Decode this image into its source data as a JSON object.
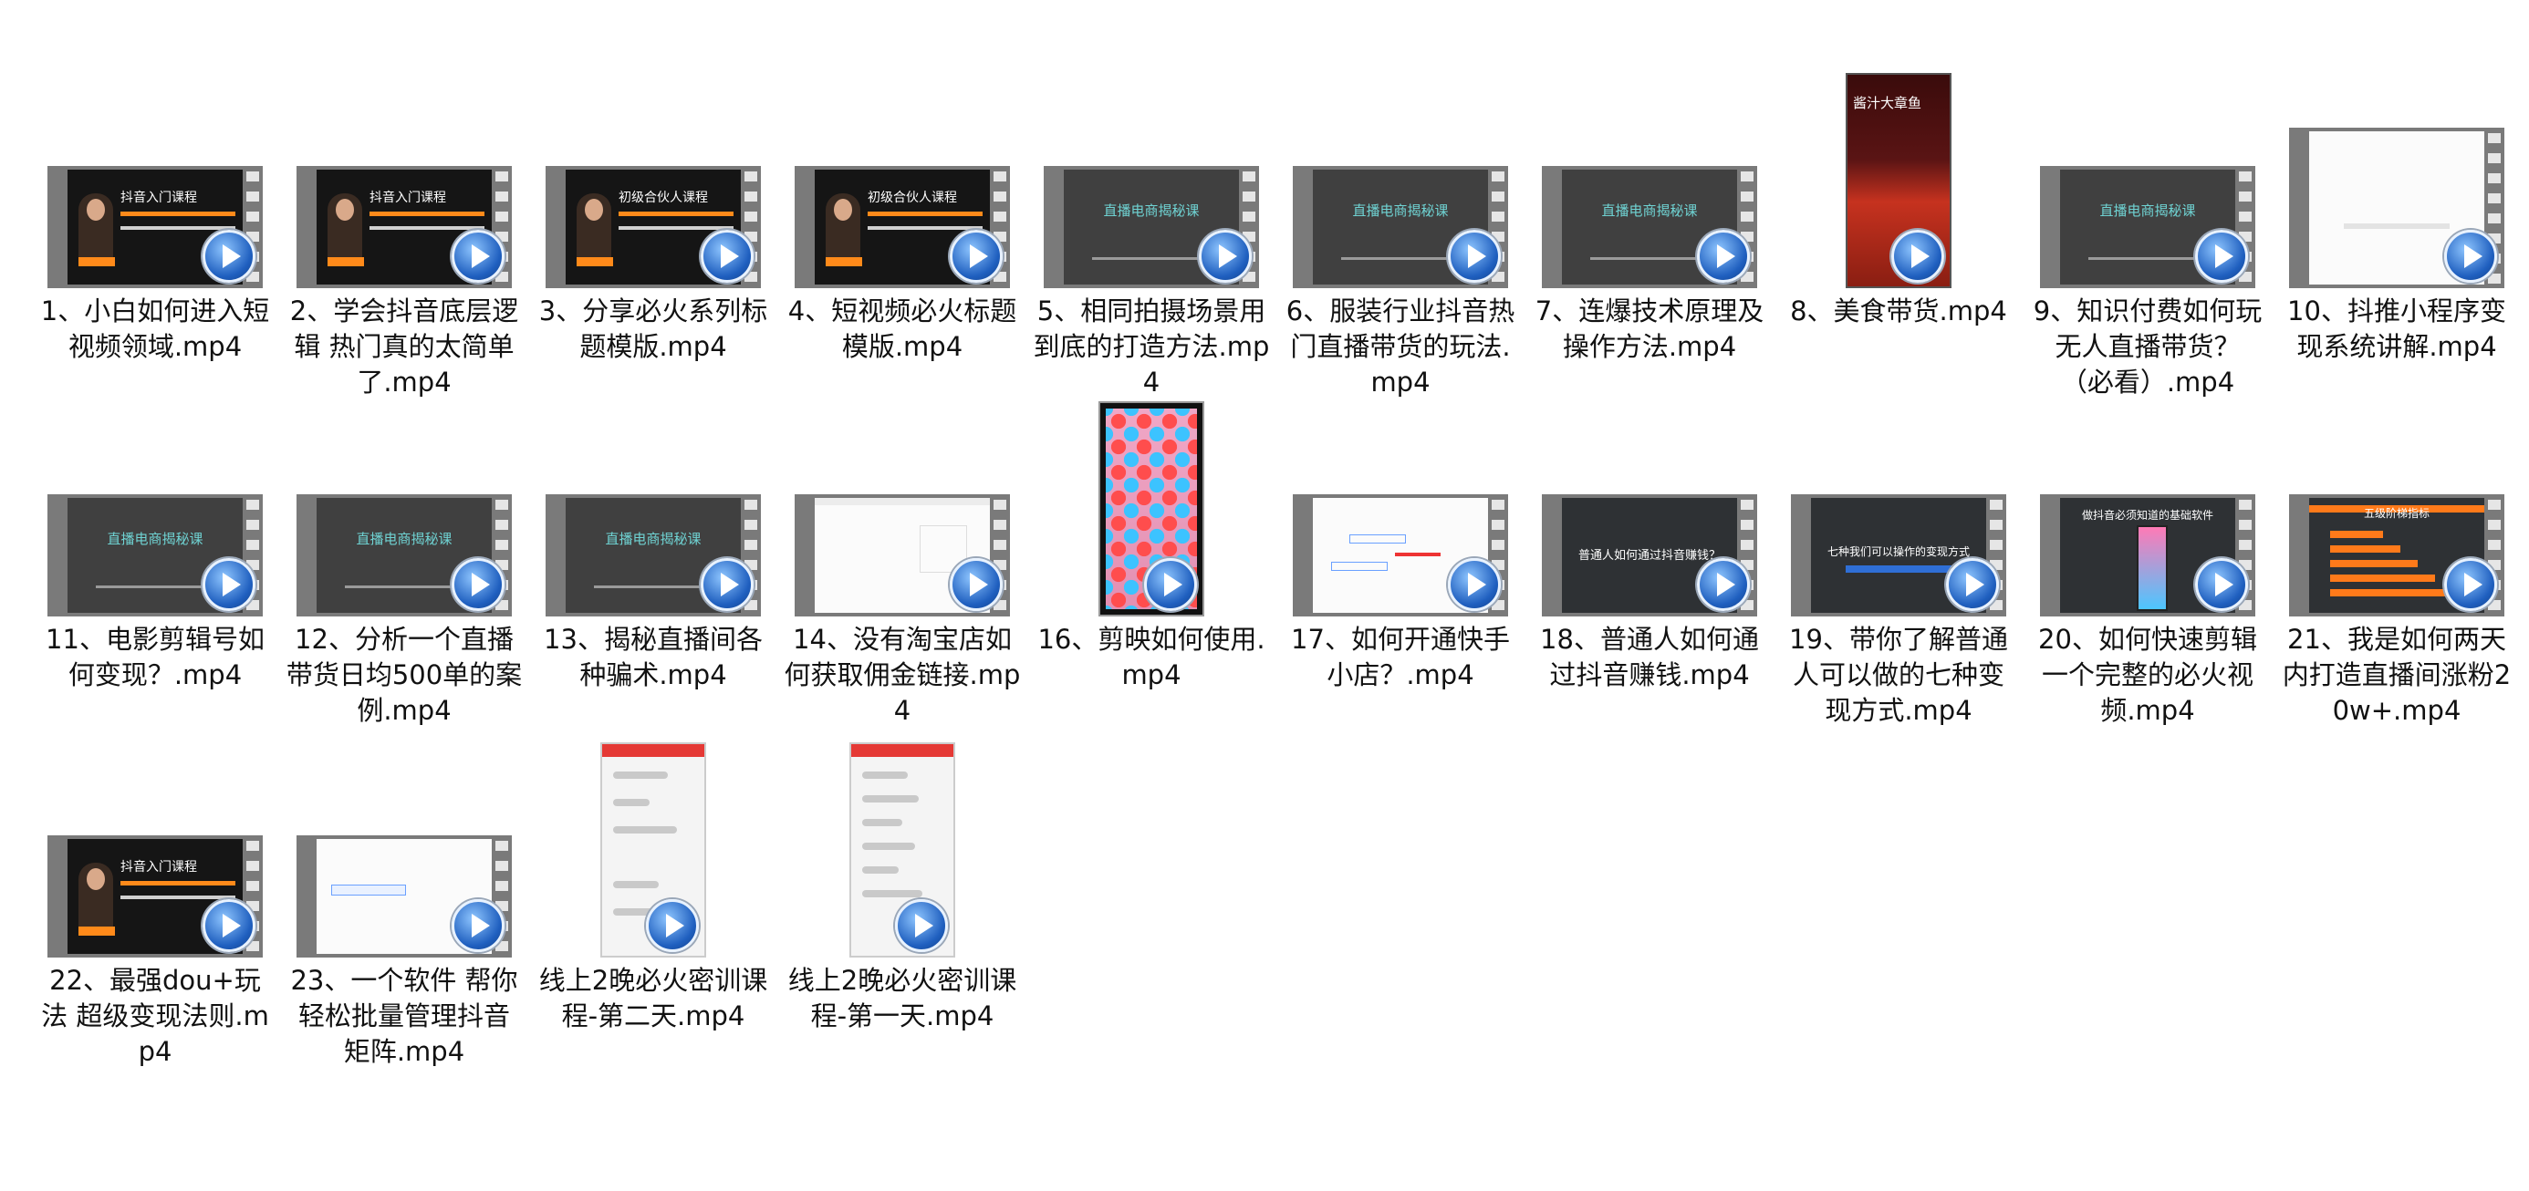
{
  "files": [
    {
      "label": "1、小白如何进入短视频领域.mp4",
      "thumb": "course"
    },
    {
      "label": "2、学会抖音底层逻辑 热门真的太简单了.mp4",
      "thumb": "course"
    },
    {
      "label": "3、分享必火系列标题模版.mp4",
      "thumb": "course"
    },
    {
      "label": "4、短视频必火标题模版.mp4",
      "thumb": "course"
    },
    {
      "label": "5、相同拍摄场景用到底的打造方法.mp4",
      "thumb": "live"
    },
    {
      "label": "6、服装行业抖音热门直播带货的玩法.mp4",
      "thumb": "live"
    },
    {
      "label": "7、连爆技术原理及操作方法.mp4",
      "thumb": "live"
    },
    {
      "label": "8、美食带货.mp4",
      "thumb": "food"
    },
    {
      "label": "9、知识付费如何玩无人直播带货？（必看）.mp4",
      "thumb": "live"
    },
    {
      "label": "10、抖推小程序变现系统讲解.mp4",
      "thumb": "white"
    },
    {
      "label": "11、电影剪辑号如何变现？.mp4",
      "thumb": "live"
    },
    {
      "label": "12、分析一个直播带货日均500单的案例.mp4",
      "thumb": "live"
    },
    {
      "label": "13、揭秘直播间各种骗术.mp4",
      "thumb": "live"
    },
    {
      "label": "14、没有淘宝店如何获取佣金链接.mp4",
      "thumb": "white"
    },
    {
      "label": "16、剪映如何使用.mp4",
      "thumb": "phone"
    },
    {
      "label": "17、如何开通快手小店？.mp4",
      "thumb": "white"
    },
    {
      "label": "18、普通人如何通过抖音赚钱.mp4",
      "thumb": "gray"
    },
    {
      "label": "19、带你了解普通人可以做的七种变现方式.mp4",
      "thumb": "gray"
    },
    {
      "label": "20、如何快速剪辑一个完整的必火视频.mp4",
      "thumb": "gray"
    },
    {
      "label": "21、我是如何两天内打造直播间涨粉20w+.mp4",
      "thumb": "bars"
    },
    {
      "label": "22、最强dou+玩法 超级变现法则.mp4",
      "thumb": "course"
    },
    {
      "label": "23、一个软件 帮你轻松批量管理抖音矩阵.mp4",
      "thumb": "white"
    },
    {
      "label": "线上2晚必火密训课程-第二天.mp4",
      "thumb": "chat"
    },
    {
      "label": "线上2晚必火密训课程-第一天.mp4",
      "thumb": "chat"
    }
  ],
  "thumb_text": {
    "course_1": "抖音入门课程",
    "course_2": "抖音入门课程",
    "course_3": "初级合伙人课程",
    "course_4": "初级合伙人课程",
    "course_22": "抖音入门课程",
    "live": "直播电商揭秘课",
    "food": "酱汁大章鱼",
    "gray_18": "普通人如何通过抖音赚钱？",
    "gray_19": "七种我们可以操作的变现方式",
    "gray_20": "做抖音必须知道的基础软件",
    "bars_21": "五级阶梯指标"
  },
  "colors": {
    "play": "#1f5fbf",
    "accent": "#ff8a1a"
  }
}
